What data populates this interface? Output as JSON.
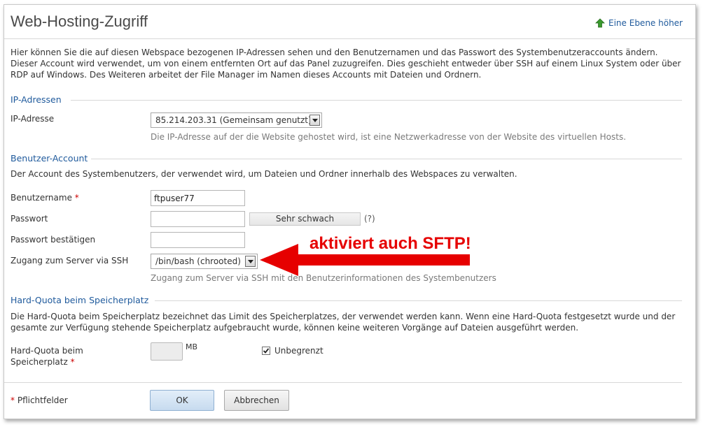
{
  "header": {
    "title": "Web-Hosting-Zugriff",
    "up_link_label": "Eine Ebene höher"
  },
  "intro_text": "Hier können Sie die auf diesen Webspace bezogenen IP-Adressen sehen und den Benutzernamen und das Passwort des Systembenutzeraccounts ändern. Dieser Account wird verwendet, um von einem entfernten Ort auf das Panel zuzugreifen. Dies geschieht entweder über SSH auf einem Linux System oder über RDP auf Windows. Des Weiteren arbeitet der File Manager im Namen dieses Accounts mit Dateien und Ordnern.",
  "ip_section": {
    "title": "IP-Adressen",
    "ip_label": "IP-Adresse",
    "ip_selected": "85.214.203.31 (Gemeinsam genutzt)",
    "ip_hint": "Die IP-Adresse auf der die Website gehostet wird, ist eine Netzwerkadresse von der Website des virtuellen Hosts."
  },
  "account_section": {
    "title": "Benutzer-Account",
    "description": "Der Account des Systembenutzers, der verwendet wird, um Dateien und Ordner innerhalb des Webspaces zu verwalten.",
    "username_label": "Benutzername",
    "required_mark": "*",
    "username_value": "ftpuser77",
    "password_label": "Passwort",
    "password_strength": "Sehr schwach",
    "password_help": "(?)",
    "password_confirm_label": "Passwort bestätigen",
    "ssh_label": "Zugang zum Server via SSH",
    "ssh_selected": "/bin/bash (chrooted)",
    "ssh_hint": "Zugang zum Server via SSH mit den Benutzerinformationen des Systembenutzers"
  },
  "annotation": {
    "text": "aktiviert auch SFTP!",
    "color": "#e60000"
  },
  "quota_section": {
    "title": "Hard-Quota beim Speicherplatz",
    "description": "Die Hard-Quota beim Speicherplatz bezeichnet das Limit des Speicherplatzes, der verwendet werden kann. Wenn eine Hard-Quota festgesetzt wurde und der gesamte zur Verfügung stehende Speicherplatz aufgebraucht wurde, können keine weiteren Vorgänge auf Dateien ausgeführt werden.",
    "quota_label_line1": "Hard-Quota beim",
    "quota_label_line2": "Speicherplatz",
    "unit": "MB",
    "unlimited_label": "Unbegrenzt",
    "unlimited_checked": true
  },
  "footer": {
    "required_note": "Pflichtfelder",
    "ok_label": "OK",
    "cancel_label": "Abbrechen"
  },
  "colors": {
    "link": "#1f5a9c",
    "required": "#cc0000",
    "up_icon": "#3a9a2e"
  }
}
